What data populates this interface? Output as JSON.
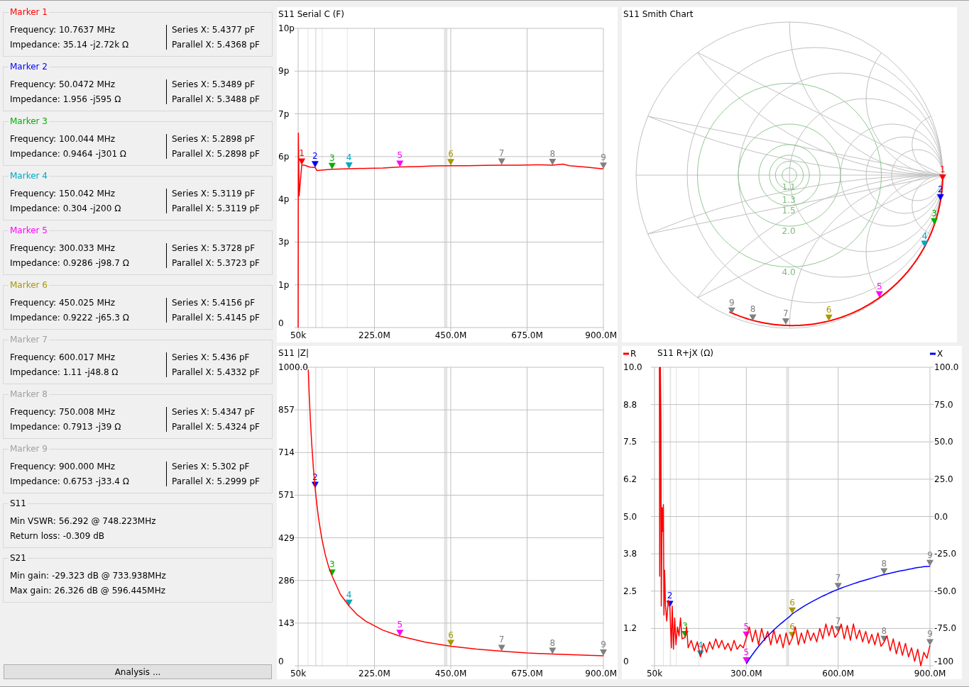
{
  "markers": [
    {
      "title": "Marker 1",
      "color": "#ff0000",
      "left": [
        "Frequency: 10.7637 MHz",
        "Impedance: 35.14 -j2.72k Ω"
      ],
      "right": [
        "Series X: 5.4377 pF",
        "Parallel X: 5.4368 pF"
      ]
    },
    {
      "title": "Marker 2",
      "color": "#0000ff",
      "left": [
        "Frequency: 50.0472 MHz",
        "Impedance: 1.956 -j595 Ω"
      ],
      "right": [
        "Series X: 5.3489 pF",
        "Parallel X: 5.3488 pF"
      ]
    },
    {
      "title": "Marker 3",
      "color": "#00b000",
      "left": [
        "Frequency: 100.044 MHz",
        "Impedance: 0.9464 -j301 Ω"
      ],
      "right": [
        "Series X: 5.2898 pF",
        "Parallel X: 5.2898 pF"
      ]
    },
    {
      "title": "Marker 4",
      "color": "#00a8c0",
      "left": [
        "Frequency: 150.042 MHz",
        "Impedance: 0.304 -j200 Ω"
      ],
      "right": [
        "Series X: 5.3119 pF",
        "Parallel X: 5.3119 pF"
      ]
    },
    {
      "title": "Marker 5",
      "color": "#ff00ff",
      "left": [
        "Frequency: 300.033 MHz",
        "Impedance: 0.9286 -j98.7 Ω"
      ],
      "right": [
        "Series X: 5.3728 pF",
        "Parallel X: 5.3723 pF"
      ]
    },
    {
      "title": "Marker 6",
      "color": "#a89800",
      "left": [
        "Frequency: 450.025 MHz",
        "Impedance: 0.9222 -j65.3 Ω"
      ],
      "right": [
        "Series X: 5.4156 pF",
        "Parallel X: 5.4145 pF"
      ]
    },
    {
      "title": "Marker 7",
      "color": "#a0a0a0",
      "left": [
        "Frequency: 600.017 MHz",
        "Impedance: 1.11 -j48.8 Ω"
      ],
      "right": [
        "Series X: 5.436 pF",
        "Parallel X: 5.4332 pF"
      ]
    },
    {
      "title": "Marker 8",
      "color": "#a0a0a0",
      "left": [
        "Frequency: 750.008 MHz",
        "Impedance: 0.7913 -j39 Ω"
      ],
      "right": [
        "Series X: 5.4347 pF",
        "Parallel X: 5.4324 pF"
      ]
    },
    {
      "title": "Marker 9",
      "color": "#a0a0a0",
      "left": [
        "Frequency: 900.000 MHz",
        "Impedance: 0.6753 -j33.4 Ω"
      ],
      "right": [
        "Series X: 5.302 pF",
        "Parallel X: 5.2999 pF"
      ]
    }
  ],
  "summaries": [
    {
      "title": "S11",
      "rows": [
        "Min VSWR: 56.292 @ 748.223MHz",
        "Return loss: -0.309 dB"
      ]
    },
    {
      "title": "S21",
      "rows": [
        "Min gain: -29.323 dB @ 733.938MHz",
        "Max gain: 26.326 dB @ 596.445MHz"
      ]
    }
  ],
  "analysis_button": {
    "label": "Analysis ..."
  },
  "charts": [
    {
      "kind": "line",
      "markers": [
        {
          "color": "#ff0000"
        },
        {
          "color": "#0000ff"
        },
        {
          "color": "#00b000"
        },
        {
          "color": "#00a8c0"
        },
        {
          "color": "#ff00ff"
        },
        {
          "color": "#a89800"
        },
        {
          "color": "#808080"
        },
        {
          "color": "#808080"
        },
        {
          "color": "#808080"
        }
      ],
      "chart_data": {
        "type": "line",
        "title": "S11 Serial C (F)",
        "grid": true,
        "x": [
          50000,
          600000,
          3000000,
          10763700,
          20000000,
          35000000,
          50047200,
          55000000,
          80000000,
          100044000,
          150042000,
          200000000,
          250000000,
          300033000,
          350000000,
          400000000,
          450025000,
          500000000,
          550000000,
          600017000,
          650000000,
          700000000,
          750008000,
          780000000,
          800000000,
          850000000,
          900000000
        ],
        "series": [
          {
            "color": "#ff0000",
            "values": [
              0,
              6.5,
              4.4,
              5.44,
              5.42,
              5.36,
              5.35,
              5.25,
              5.27,
              5.29,
              5.31,
              5.32,
              5.33,
              5.37,
              5.38,
              5.4,
              5.41,
              5.41,
              5.42,
              5.43,
              5.43,
              5.44,
              5.43,
              5.46,
              5.41,
              5.36,
              5.3
            ]
          }
        ],
        "xlim": [
          50000,
          900000000
        ],
        "ylim": [
          0,
          10
        ],
        "xticks": [
          {
            "value": 50000,
            "label": "50k"
          },
          {
            "value": 225000000,
            "label": "225.0M"
          },
          {
            "value": 450000000,
            "label": "450.0M"
          },
          {
            "value": 675000000,
            "label": "675.0M"
          },
          {
            "value": 900000000,
            "label": "900.0M"
          }
        ],
        "yticks": [
          {
            "value": 0,
            "label": "0"
          },
          {
            "value": 1.4286,
            "label": "1p"
          },
          {
            "value": 2.8571,
            "label": "3p"
          },
          {
            "value": 4.2857,
            "label": "4p"
          },
          {
            "value": 5.7143,
            "label": "6p"
          },
          {
            "value": 7.1429,
            "label": "7p"
          },
          {
            "value": 8.5714,
            "label": "9p"
          },
          {
            "value": 10,
            "label": "10p"
          }
        ],
        "bands": [
          {
            "axis": "x",
            "from": 28000000,
            "to": 29700000
          },
          {
            "axis": "x",
            "from": 50000000,
            "to": 54000000
          },
          {
            "axis": "x",
            "from": 70000000,
            "to": 70500000
          },
          {
            "axis": "x",
            "from": 144000000,
            "to": 146000000
          },
          {
            "axis": "x",
            "from": 430000000,
            "to": 440000000
          }
        ],
        "annotations": [
          {
            "x": 10763700,
            "y": 5.44,
            "text": "1"
          },
          {
            "x": 50047200,
            "y": 5.35,
            "text": "2"
          },
          {
            "x": 100044000,
            "y": 5.29,
            "text": "3"
          },
          {
            "x": 150042000,
            "y": 5.31,
            "text": "4"
          },
          {
            "x": 300033000,
            "y": 5.37,
            "text": "5"
          },
          {
            "x": 450025000,
            "y": 5.42,
            "text": "6"
          },
          {
            "x": 600017000,
            "y": 5.44,
            "text": "7"
          },
          {
            "x": 750008000,
            "y": 5.43,
            "text": "8"
          },
          {
            "x": 900000000,
            "y": 5.3,
            "text": "9"
          }
        ]
      }
    },
    {
      "kind": "smith",
      "title": "S11 Smith Chart",
      "vswr_labels": [
        "1.1",
        "1.3",
        "1.5",
        "2.0",
        "4.0"
      ],
      "markers": [
        {
          "label": "1",
          "color": "#ff0000"
        },
        {
          "label": "2",
          "color": "#0000ff"
        },
        {
          "label": "3",
          "color": "#00b000"
        },
        {
          "label": "4",
          "color": "#00a8c0"
        },
        {
          "label": "5",
          "color": "#ff00ff"
        },
        {
          "label": "6",
          "color": "#a89800"
        },
        {
          "label": "7",
          "color": "#808080"
        },
        {
          "label": "8",
          "color": "#808080"
        },
        {
          "label": "9",
          "color": "#808080"
        }
      ]
    },
    {
      "kind": "line",
      "markers": [
        {
          "color": "#0000ff"
        },
        {
          "color": "#00b000"
        },
        {
          "color": "#00a8c0"
        },
        {
          "color": "#ff00ff"
        },
        {
          "color": "#a89800"
        },
        {
          "color": "#808080"
        },
        {
          "color": "#808080"
        },
        {
          "color": "#808080"
        }
      ],
      "chart_data": {
        "type": "line",
        "title": "S11 |Z|",
        "grid": true,
        "x": [
          30000000,
          33000000,
          36000000,
          40000000,
          45000000,
          50047200,
          55000000,
          60000000,
          70000000,
          80000000,
          90000000,
          100044000,
          125000000,
          150042000,
          175000000,
          200000000,
          250000000,
          300033000,
          375000000,
          450025000,
          525000000,
          600017000,
          675000000,
          750008000,
          825000000,
          900000000
        ],
        "series": [
          {
            "color": "#ff0000",
            "values": [
              992,
              901,
              826,
              744,
              661,
              595,
              541,
              496,
              425,
              372,
              331,
              301,
              238,
              200,
              170,
              149,
              119,
              99,
              79,
              65,
              56,
              49,
              43,
              39,
              36,
              33
            ]
          }
        ],
        "xlim": [
          50000,
          900000000
        ],
        "ylim": [
          0,
          1000
        ],
        "xticks": [
          {
            "value": 50000,
            "label": "50k"
          },
          {
            "value": 225000000,
            "label": "225.0M"
          },
          {
            "value": 450000000,
            "label": "450.0M"
          },
          {
            "value": 675000000,
            "label": "675.0M"
          },
          {
            "value": 900000000,
            "label": "900.0M"
          }
        ],
        "yticks": [
          {
            "value": 0,
            "label": "0"
          },
          {
            "value": 142.86,
            "label": "143"
          },
          {
            "value": 285.71,
            "label": "286"
          },
          {
            "value": 428.57,
            "label": "429"
          },
          {
            "value": 571.43,
            "label": "571"
          },
          {
            "value": 714.29,
            "label": "714"
          },
          {
            "value": 857.14,
            "label": "857"
          },
          {
            "value": 1000,
            "label": "1000.0"
          }
        ],
        "bands": [
          {
            "axis": "x",
            "from": 28000000,
            "to": 29700000
          },
          {
            "axis": "x",
            "from": 50000000,
            "to": 54000000
          },
          {
            "axis": "x",
            "from": 70000000,
            "to": 70500000
          },
          {
            "axis": "x",
            "from": 144000000,
            "to": 146000000
          },
          {
            "axis": "x",
            "from": 430000000,
            "to": 440000000
          }
        ],
        "annotations": [
          {
            "x": 50047200,
            "y": 595,
            "text": "2"
          },
          {
            "x": 100044000,
            "y": 301,
            "text": "3"
          },
          {
            "x": 150042000,
            "y": 200,
            "text": "4"
          },
          {
            "x": 300033000,
            "y": 99,
            "text": "5"
          },
          {
            "x": 450025000,
            "y": 65,
            "text": "6"
          },
          {
            "x": 600017000,
            "y": 49,
            "text": "7"
          },
          {
            "x": 750008000,
            "y": 39,
            "text": "8"
          },
          {
            "x": 900000000,
            "y": 33,
            "text": "9"
          }
        ]
      }
    },
    {
      "kind": "line",
      "markers": [
        {
          "color": "#0000ff"
        },
        {
          "color": "#00b000"
        },
        {
          "color": "#00a8c0"
        },
        {
          "color": "#ff00ff"
        },
        {
          "color": "#a89800"
        },
        {
          "color": "#808080"
        },
        {
          "color": "#808080"
        },
        {
          "color": "#808080"
        },
        {
          "color": "#ff00ff"
        },
        {
          "color": "#a89800"
        },
        {
          "color": "#808080"
        },
        {
          "color": "#808080"
        },
        {
          "color": "#808080"
        }
      ],
      "chart_data": {
        "type": "line",
        "title": "S11 R+jX (Ω)",
        "grid": true,
        "legend": "top",
        "x": [
          16000000,
          17000000,
          19000000,
          21000000,
          22000000,
          25000000,
          27000000,
          29000000,
          31000000,
          33000000,
          36000000,
          40000000,
          45000000,
          50047200,
          55000000,
          58000000,
          62000000,
          66000000,
          70000000,
          75000000,
          80000000,
          85000000,
          90000000,
          100044000,
          105000000,
          110000000,
          120000000,
          130000000,
          140000000,
          150042000,
          160000000,
          170000000,
          180000000,
          190000000,
          200000000,
          210000000,
          220000000,
          230000000,
          240000000,
          250000000,
          260000000,
          270000000,
          280000000,
          290000000,
          300033000,
          310000000,
          320000000,
          330000000,
          340000000,
          350000000,
          360000000,
          370000000,
          380000000,
          390000000,
          400000000,
          410000000,
          420000000,
          430000000,
          440000000,
          450025000,
          460000000,
          470000000,
          480000000,
          490000000,
          500000000,
          510000000,
          520000000,
          530000000,
          540000000,
          550000000,
          560000000,
          570000000,
          580000000,
          590000000,
          600017000,
          610000000,
          620000000,
          630000000,
          640000000,
          650000000,
          660000000,
          670000000,
          680000000,
          690000000,
          700000000,
          710000000,
          720000000,
          730000000,
          740000000,
          750008000,
          760000000,
          770000000,
          780000000,
          790000000,
          800000000,
          810000000,
          820000000,
          830000000,
          840000000,
          850000000,
          860000000,
          870000000,
          880000000,
          890000000,
          900000000
        ],
        "series": [
          {
            "name": "R",
            "color": "#ff0000",
            "values": [
              10,
              3.0,
              10,
              8.2,
              2.0,
              5.3,
              4.5,
              5.4,
              1.7,
              3.2,
              2.0,
              1.5,
              2.2,
              1.96,
              0.6,
              2.0,
              0.55,
              1.6,
              0.7,
              1.3,
              1.0,
              1.6,
              0.9,
              0.95,
              1.3,
              0.6,
              0.85,
              0.5,
              0.8,
              0.3,
              0.75,
              0.45,
              0.8,
              0.55,
              0.9,
              0.6,
              0.85,
              0.55,
              0.75,
              0.5,
              0.85,
              0.55,
              0.7,
              0.6,
              0.93,
              1.3,
              0.8,
              1.2,
              0.7,
              1.25,
              0.85,
              1.15,
              0.7,
              1.2,
              0.75,
              1.05,
              0.6,
              1.1,
              0.7,
              0.92,
              1.3,
              0.7,
              1.1,
              0.75,
              1.2,
              0.85,
              1.1,
              0.8,
              1.25,
              0.9,
              1.4,
              1.0,
              1.35,
              0.95,
              1.11,
              1.4,
              0.9,
              1.35,
              0.85,
              1.4,
              0.9,
              1.2,
              0.8,
              1.15,
              0.75,
              1.05,
              0.7,
              1.1,
              0.65,
              0.79,
              1.0,
              0.5,
              0.9,
              0.4,
              0.8,
              0.35,
              0.75,
              0.3,
              0.6,
              0.15,
              0.55,
              0.0,
              0.45,
              0.25,
              0.68
            ]
          },
          {
            "name": "X",
            "color": "#0000ff",
            "axis": "y2",
            "values": [
              null,
              null,
              null,
              null,
              null,
              null,
              null,
              null,
              null,
              null,
              null,
              null,
              null,
              null,
              null,
              null,
              null,
              null,
              null,
              null,
              null,
              null,
              null,
              null,
              null,
              null,
              null,
              null,
              null,
              null,
              null,
              null,
              null,
              null,
              null,
              null,
              null,
              null,
              null,
              null,
              null,
              null,
              null,
              null,
              -98.7,
              -95.5,
              -92.5,
              -89.7,
              -87.1,
              -84.6,
              -82.3,
              -80.1,
              -78.0,
              -76.0,
              -74.1,
              -72.3,
              -70.6,
              -68.9,
              -67.3,
              -65.3,
              -63.9,
              -62.5,
              -61.2,
              -59.9,
              -58.7,
              -57.6,
              -56.5,
              -55.4,
              -54.3,
              -53.3,
              -52.4,
              -51.4,
              -50.5,
              -49.6,
              -48.8,
              -48.0,
              -47.2,
              -46.5,
              -45.8,
              -45.1,
              -44.4,
              -43.7,
              -43.1,
              -42.5,
              -41.9,
              -41.3,
              -40.7,
              -40.1,
              -39.5,
              -39.0,
              -38.5,
              -38.0,
              -37.5,
              -37.0,
              -36.6,
              -36.2,
              -35.8,
              -35.4,
              -35.0,
              -34.6,
              -34.2,
              -33.9,
              -33.6,
              -33.5,
              -33.4
            ]
          }
        ],
        "xlim": [
          50000,
          900000000
        ],
        "ylim": [
          0,
          10
        ],
        "y2lim": [
          -100,
          100
        ],
        "xticks": [
          {
            "value": 50000,
            "label": "50k"
          },
          {
            "value": 300000000,
            "label": "300.0M"
          },
          {
            "value": 600000000,
            "label": "600.0M"
          },
          {
            "value": 900000000,
            "label": "900.0M"
          }
        ],
        "yticks": [
          {
            "value": 0,
            "label": "0"
          },
          {
            "value": 1.25,
            "label": "1.2"
          },
          {
            "value": 2.5,
            "label": "2.5"
          },
          {
            "value": 3.75,
            "label": "3.8"
          },
          {
            "value": 5,
            "label": "5.0"
          },
          {
            "value": 6.25,
            "label": "6.2"
          },
          {
            "value": 7.5,
            "label": "7.5"
          },
          {
            "value": 8.75,
            "label": "8.8"
          },
          {
            "value": 10,
            "label": "10.0"
          }
        ],
        "y2ticks": [
          {
            "value": -100,
            "label": "-100"
          },
          {
            "value": -75,
            "label": "-75.0"
          },
          {
            "value": -50,
            "label": "-50.0"
          },
          {
            "value": -25,
            "label": "-25.0"
          },
          {
            "value": 0,
            "label": "0.0"
          },
          {
            "value": 25,
            "label": "25.0"
          },
          {
            "value": 50,
            "label": "50.0"
          },
          {
            "value": 75,
            "label": "75.0"
          },
          {
            "value": 100,
            "label": "100.0"
          }
        ],
        "bands": [
          {
            "axis": "x",
            "from": 28000000,
            "to": 29700000
          },
          {
            "axis": "x",
            "from": 50000000,
            "to": 54000000
          },
          {
            "axis": "x",
            "from": 70000000,
            "to": 70500000
          },
          {
            "axis": "x",
            "from": 144000000,
            "to": 146000000
          },
          {
            "axis": "x",
            "from": 430000000,
            "to": 440000000
          }
        ],
        "annotations": [
          {
            "x": 50047200,
            "y": 1.96,
            "text": "2"
          },
          {
            "x": 100044000,
            "y": 0.95,
            "text": "3"
          },
          {
            "x": 150042000,
            "y": 0.3,
            "text": "4"
          },
          {
            "x": 300033000,
            "y": 0.93,
            "text": "5"
          },
          {
            "x": 450025000,
            "y": 0.92,
            "text": "6"
          },
          {
            "x": 600017000,
            "y": 1.11,
            "text": "7"
          },
          {
            "x": 750008000,
            "y": 0.79,
            "text": "8"
          },
          {
            "x": 900000000,
            "y": 0.68,
            "text": "9"
          },
          {
            "x": 300033000,
            "y": 0.07,
            "text": "5"
          },
          {
            "x": 450025000,
            "y": 1.74,
            "text": "6"
          },
          {
            "x": 600017000,
            "y": 2.56,
            "text": "7"
          },
          {
            "x": 750008000,
            "y": 3.05,
            "text": "8"
          },
          {
            "x": 900000000,
            "y": 3.33,
            "text": "9"
          }
        ]
      }
    }
  ]
}
